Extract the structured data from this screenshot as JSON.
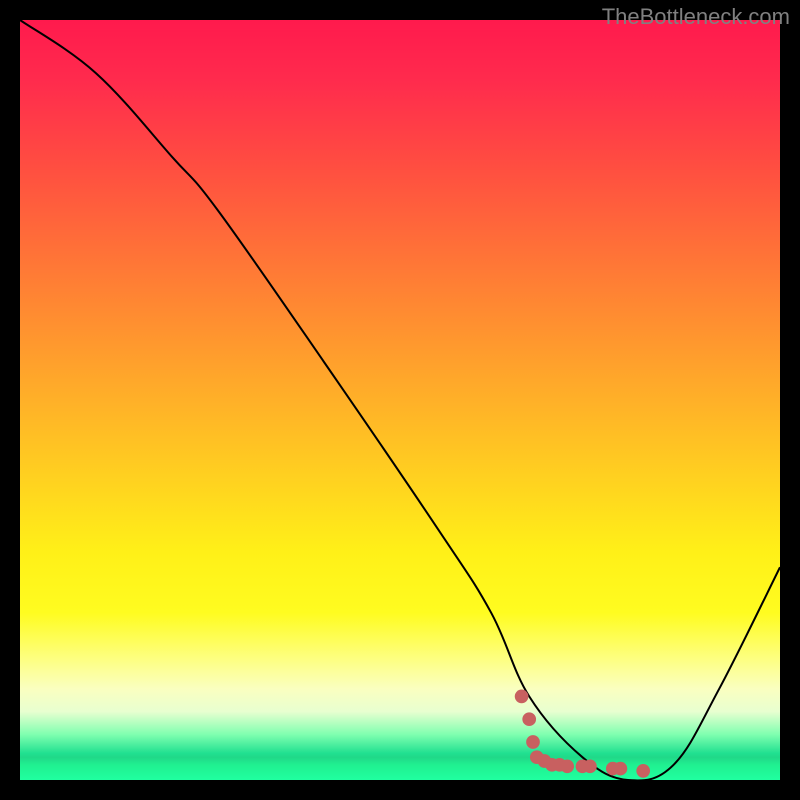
{
  "watermark": "TheBottleneck.com",
  "chart_data": {
    "type": "line",
    "title": "",
    "xlabel": "",
    "ylabel": "",
    "xlim": [
      0,
      100
    ],
    "ylim": [
      0,
      100
    ],
    "series": [
      {
        "name": "bottleneck-curve",
        "x": [
          0,
          10,
          20,
          26,
          40,
          55,
          62,
          67,
          74,
          80,
          86,
          92,
          100
        ],
        "values": [
          100,
          93,
          82,
          75,
          55,
          33,
          22,
          11,
          3,
          0,
          2,
          12,
          28
        ]
      }
    ],
    "markers": {
      "name": "data-points",
      "color": "#c86060",
      "points": [
        {
          "x": 66,
          "y": 11
        },
        {
          "x": 67,
          "y": 8
        },
        {
          "x": 67.5,
          "y": 5
        },
        {
          "x": 68,
          "y": 3
        },
        {
          "x": 69,
          "y": 2.5
        },
        {
          "x": 70,
          "y": 2
        },
        {
          "x": 71,
          "y": 2
        },
        {
          "x": 72,
          "y": 1.8
        },
        {
          "x": 74,
          "y": 1.8
        },
        {
          "x": 75,
          "y": 1.8
        },
        {
          "x": 78,
          "y": 1.5
        },
        {
          "x": 79,
          "y": 1.5
        },
        {
          "x": 82,
          "y": 1.2
        }
      ]
    },
    "gradient_stops": [
      {
        "pos": 0,
        "color": "#ff1a4d"
      },
      {
        "pos": 0.5,
        "color": "#ffd020"
      },
      {
        "pos": 0.85,
        "color": "#fdff80"
      },
      {
        "pos": 0.97,
        "color": "#20e090"
      },
      {
        "pos": 1.0,
        "color": "#20ffa0"
      }
    ]
  }
}
